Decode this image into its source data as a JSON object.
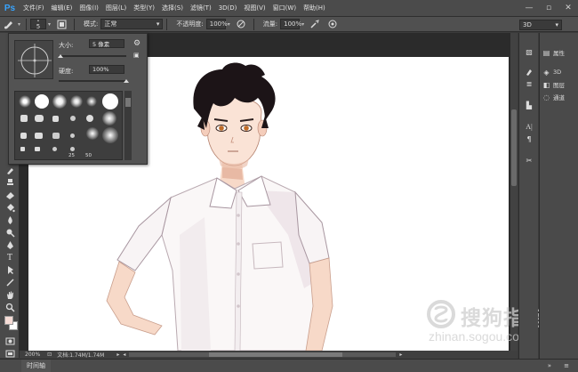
{
  "app": {
    "logo": "Ps"
  },
  "menu": [
    "文件(F)",
    "编辑(E)",
    "图像(I)",
    "图层(L)",
    "类型(Y)",
    "选择(S)",
    "滤镜(T)",
    "3D(D)",
    "视图(V)",
    "窗口(W)",
    "帮助(H)"
  ],
  "window_controls": {
    "minimize": "—",
    "restore": "▫",
    "close": "✕"
  },
  "options": {
    "brush_size": "5",
    "mode_label": "模式:",
    "mode_value": "正常",
    "opacity_label": "不透明度:",
    "opacity_value": "100%",
    "flow_label": "流量:",
    "flow_value": "100%",
    "workspace": "3D"
  },
  "brush_popup": {
    "size_label": "大小:",
    "size_value": "5 像素",
    "hardness_label": "硬度:",
    "hardness_value": "100%",
    "size_fraction": 0.02,
    "hardness_fraction": 1.0,
    "preset_numbers": [
      "25",
      "50"
    ]
  },
  "status": {
    "zoom": "200%",
    "doc_info": "文档:1.74M/1.74M"
  },
  "timeline": {
    "tab_label": "时间轴"
  },
  "panels": [
    {
      "icon": "properties-icon",
      "glyph": "▤",
      "label": "属性"
    },
    {
      "icon": "3d-icon",
      "glyph": "◈",
      "label": "3D"
    },
    {
      "icon": "layers-icon",
      "glyph": "◧",
      "label": "图层"
    },
    {
      "icon": "channels-icon",
      "glyph": "◌",
      "label": "通道"
    }
  ],
  "watermark": {
    "title": "搜狗指南",
    "subtitle": "zhinan.sogou.com"
  }
}
